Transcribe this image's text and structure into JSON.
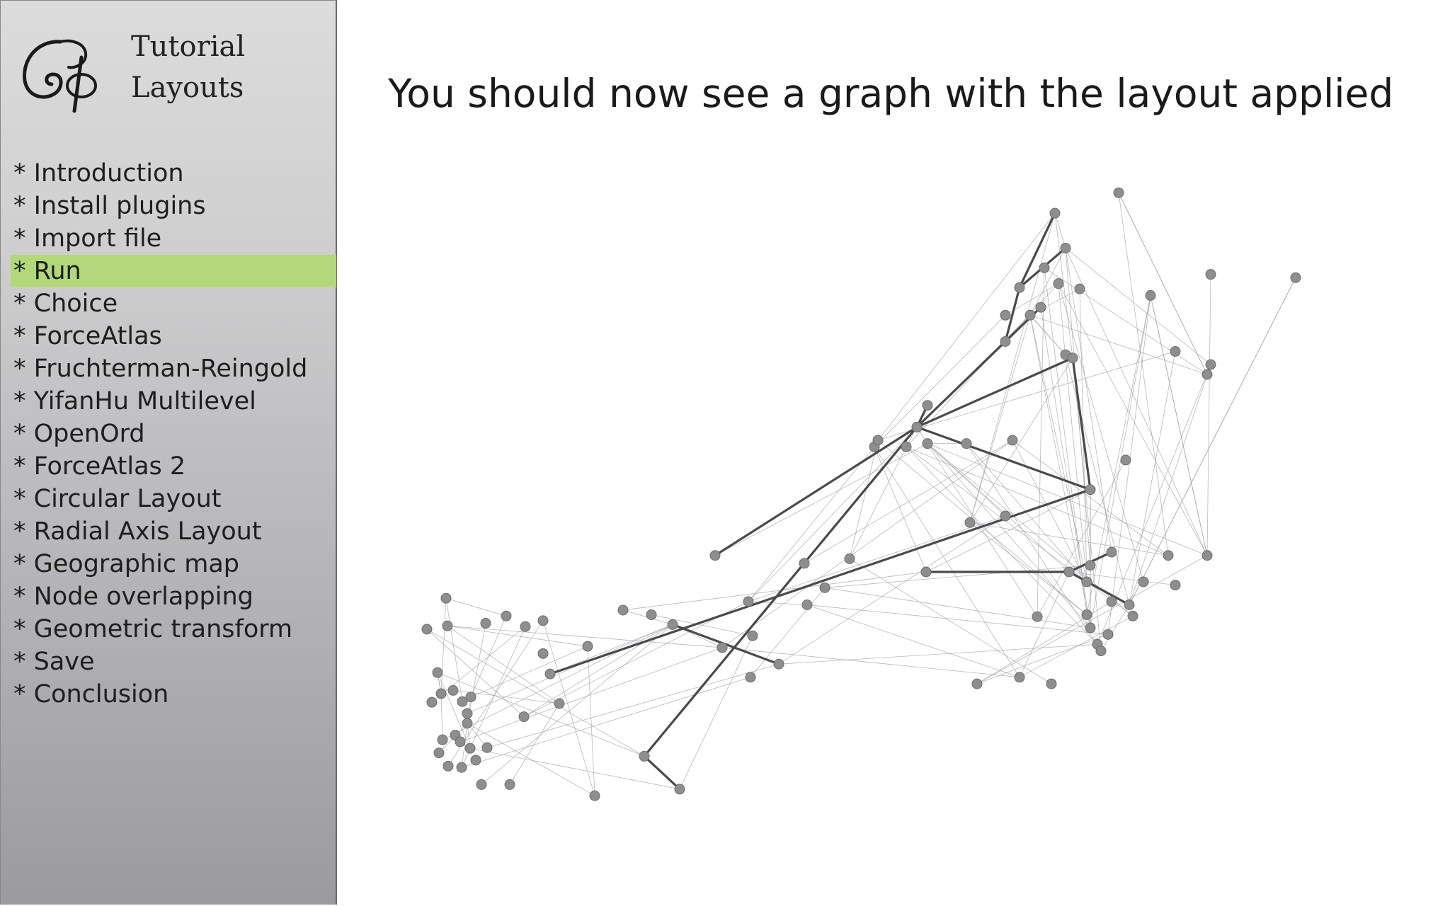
{
  "sidebar": {
    "brand": {
      "title": "Tutorial",
      "subtitle": "Layouts"
    },
    "items": [
      {
        "label": "* Introduction",
        "active": false
      },
      {
        "label": "* Install plugins",
        "active": false
      },
      {
        "label": "* Import file",
        "active": false
      },
      {
        "label": "* Run",
        "active": true
      },
      {
        "label": "* Choice",
        "active": false
      },
      {
        "label": "* ForceAtlas",
        "active": false
      },
      {
        "label": "* Fruchterman-Reingold",
        "active": false
      },
      {
        "label": "* YifanHu Multilevel",
        "active": false
      },
      {
        "label": "* OpenOrd",
        "active": false
      },
      {
        "label": "* ForceAtlas 2",
        "active": false
      },
      {
        "label": "* Circular Layout",
        "active": false
      },
      {
        "label": "* Radial Axis Layout",
        "active": false
      },
      {
        "label": "* Geographic map",
        "active": false
      },
      {
        "label": "* Node overlapping",
        "active": false
      },
      {
        "label": "* Geometric transform",
        "active": false
      },
      {
        "label": "* Save",
        "active": false
      },
      {
        "label": "* Conclusion",
        "active": false
      }
    ]
  },
  "main": {
    "title": "You should now see a graph with the layout applied"
  },
  "colors": {
    "active_item": "#b3d87a",
    "node": "#8e8e8e",
    "edge": "#9a9aa4",
    "strong_edge": "#4a4a4a"
  }
}
